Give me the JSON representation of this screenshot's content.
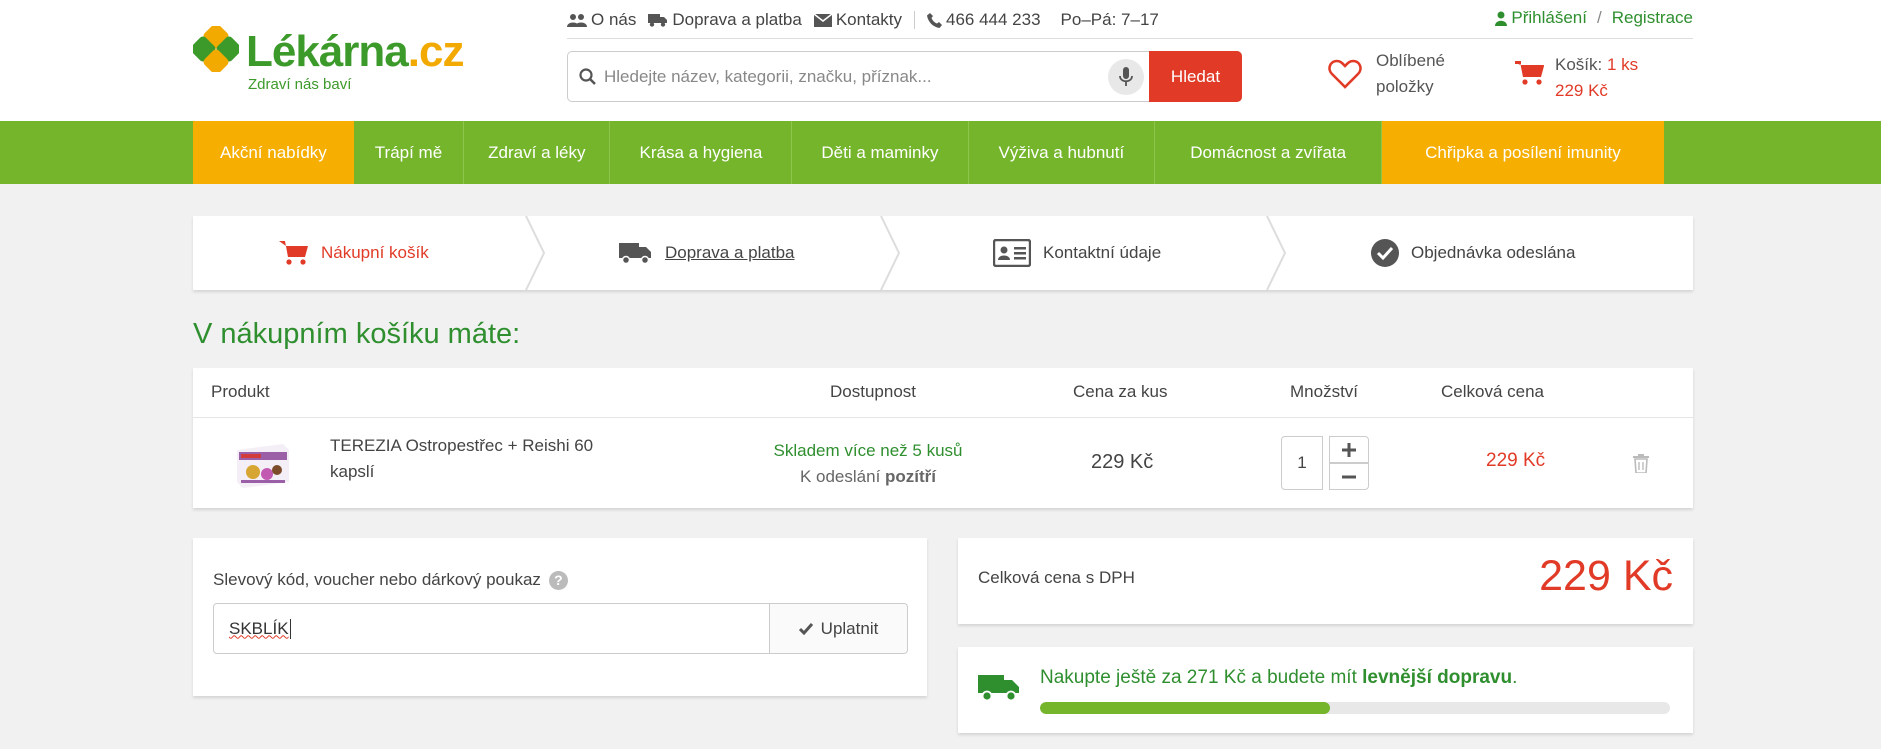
{
  "logo": {
    "brand": "Lékárna",
    "tld": ".cz",
    "tagline": "Zdraví nás baví"
  },
  "topinfo": {
    "about": "O nás",
    "shipping": "Doprava a platba",
    "contacts": "Kontakty",
    "phone": "466 444 233",
    "hours": "Po–Pá: 7–17"
  },
  "account": {
    "login": "Přihlášení",
    "separator": "/",
    "register": "Registrace"
  },
  "search": {
    "placeholder": "Hledejte název, kategorii, značku, příznak...",
    "button": "Hledat"
  },
  "favorites": {
    "line1": "Oblíbené",
    "line2": "položky"
  },
  "cart": {
    "label": "Košík:",
    "count": "1 ks",
    "total": "229 Kč"
  },
  "nav": [
    "Akční nabídky",
    "Trápí mě",
    "Zdraví a léky",
    "Krása a hygiena",
    "Děti a maminky",
    "Výživa a hubnutí",
    "Domácnost a zvířata",
    "Chřipka a posílení imunity"
  ],
  "steps": [
    "Nákupní košík",
    "Doprava a platba",
    "Kontaktní údaje",
    "Objednávka odeslána"
  ],
  "heading": "V nákupním košíku máte:",
  "table": {
    "headers": [
      "Produkt",
      "Dostupnost",
      "Cena za kus",
      "Množství",
      "Celková cena"
    ],
    "rows": [
      {
        "name": "TEREZIA Ostropestřec + Reishi 60 kapslí",
        "stock": "Skladem více než 5 kusů",
        "dispatch_prefix": "K odeslání",
        "dispatch_day": "pozítří",
        "unit_price": "229 Kč",
        "quantity": "1",
        "total": "229 Kč"
      }
    ]
  },
  "voucher": {
    "label": "Slevový kód, voucher nebo dárkový poukaz",
    "help": "?",
    "value": "SKBLÍK",
    "button": "Uplatnit"
  },
  "summary": {
    "label": "Celková cena s DPH",
    "value": "229 Kč"
  },
  "shipping_promo": {
    "prefix": "Nakupte ještě za 271 Kč a budete mít",
    "bold": "levnější dopravu",
    "suffix": ".",
    "progress": 0.46
  },
  "colors": {
    "green": "#74b52c",
    "dark_green": "#2f8f2f",
    "orange": "#f6ae00",
    "red": "#e13b27"
  }
}
